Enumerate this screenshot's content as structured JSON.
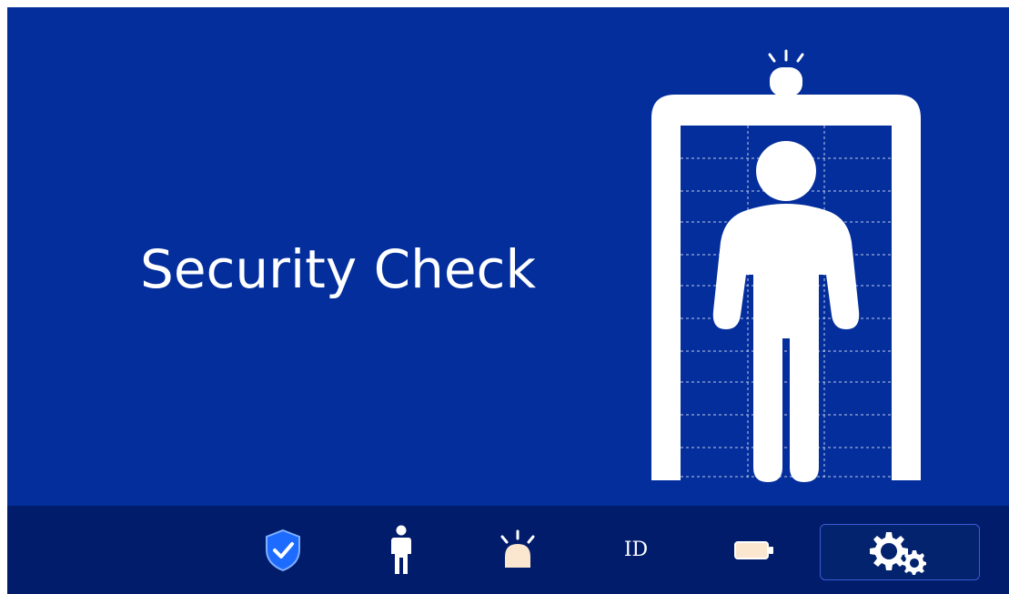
{
  "screen": {
    "title": "Security Check"
  },
  "illustration": {
    "name": "walk-through-metal-detector"
  },
  "bottom_bar": {
    "items": [
      {
        "name": "shield-check-icon"
      },
      {
        "name": "person-icon"
      },
      {
        "name": "alarm-light-icon"
      },
      {
        "name": "id-label",
        "label": "ID"
      },
      {
        "name": "battery-icon"
      },
      {
        "name": "settings-gears-icon"
      }
    ]
  },
  "colors": {
    "background": "#032e9c",
    "bottom_bar": "#021c6c",
    "accent": "#1e6cff",
    "foreground": "#ffffff"
  }
}
